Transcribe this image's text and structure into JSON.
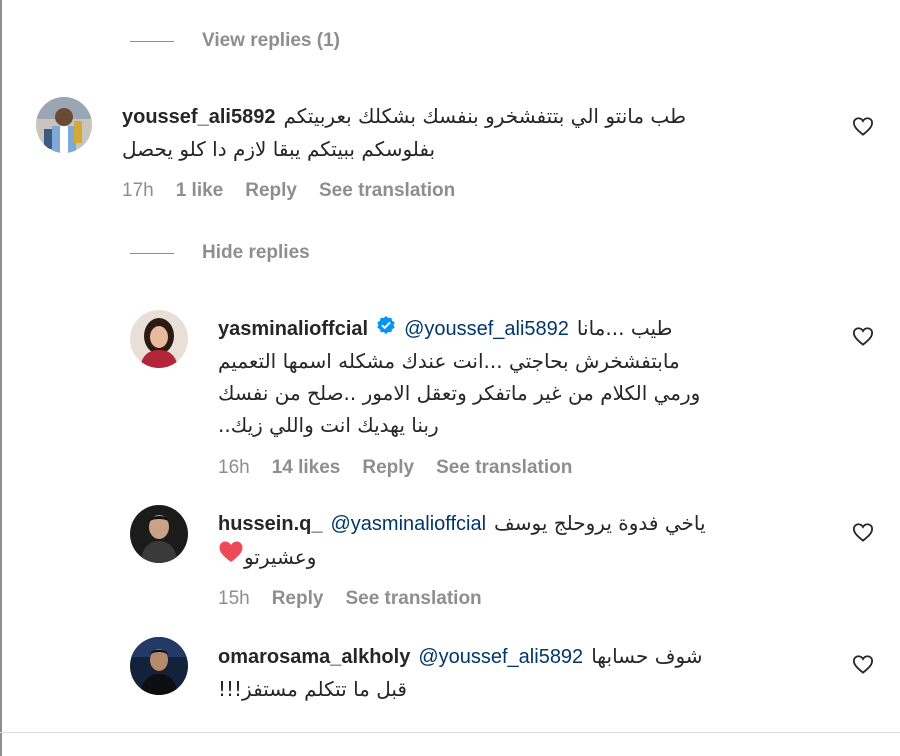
{
  "thread": {
    "view_replies_label": "View replies (1)",
    "hide_replies_label": "Hide replies"
  },
  "comments": [
    {
      "username": "youssef_ali5892",
      "lines": [
        "طب مانتو الي بتتفشخرو بنفسك بشكلك بعربيتكم",
        "بفلوسكم ببيتكم يبقا لازم دا كلو يحصل"
      ],
      "time": "17h",
      "likes": "1 like",
      "reply": "Reply",
      "translate": "See translation"
    }
  ],
  "replies": [
    {
      "username": "yasminalioffcial",
      "verified": true,
      "mention": "@youssef_ali5892",
      "lines": [
        "طيب ...مانا",
        "مابتفشخرش بحاجتي ...انت عندك مشكله اسمها التعميم",
        "ورمي الكلام من غير ماتفكر وتعقل الامور ..صلح من نفسك",
        "ربنا يهديك انت واللي زيك.."
      ],
      "time": "16h",
      "likes": "14 likes",
      "reply": "Reply",
      "translate": "See translation"
    },
    {
      "username": "hussein.q_",
      "mention": "@yasminalioffcial",
      "lines": [
        "ياخي فدوة يروحلج يوسف",
        "وعشيرتو"
      ],
      "time": "15h",
      "reply": "Reply",
      "translate": "See translation"
    },
    {
      "username": "omarosama_alkholy",
      "mention": "@youssef_ali5892",
      "lines": [
        "شوف حسابها",
        "قبل ما تتكلم مستفز!!!"
      ],
      "icons": [
        "heart-outline-icon"
      ]
    }
  ],
  "colors": {
    "text": "#262626",
    "muted": "#8e8e8e",
    "mention": "#00376b",
    "verified": "#0095f6",
    "heart_red": "#ed4956"
  }
}
